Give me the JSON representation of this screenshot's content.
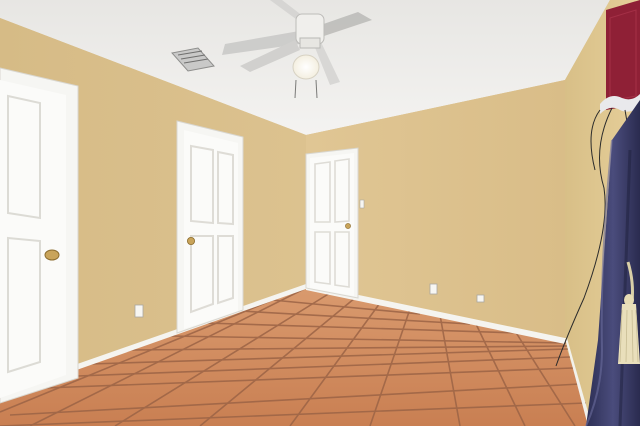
{
  "scene": {
    "description_kind": "empty-room-photo",
    "colors": {
      "ceiling": "#efeeec",
      "wall_left": "#d8be8a",
      "wall_back": "#ddc290",
      "wall_right": "#e1c993",
      "door": "#fbfbf9",
      "door_frame": "#f6f6f3",
      "tile": "#d08a5e",
      "grout": "#9c6446",
      "baseboard": "#f5f4f0",
      "curtain": "#3b3d66",
      "valance": "#8f2036",
      "knob": "#c9a45a"
    },
    "objects": [
      "ceiling-fan",
      "ceiling-vent",
      "closet-door-left",
      "door-center-left",
      "door-back",
      "tile-floor",
      "curtain-right",
      "electrical-outlets"
    ]
  }
}
